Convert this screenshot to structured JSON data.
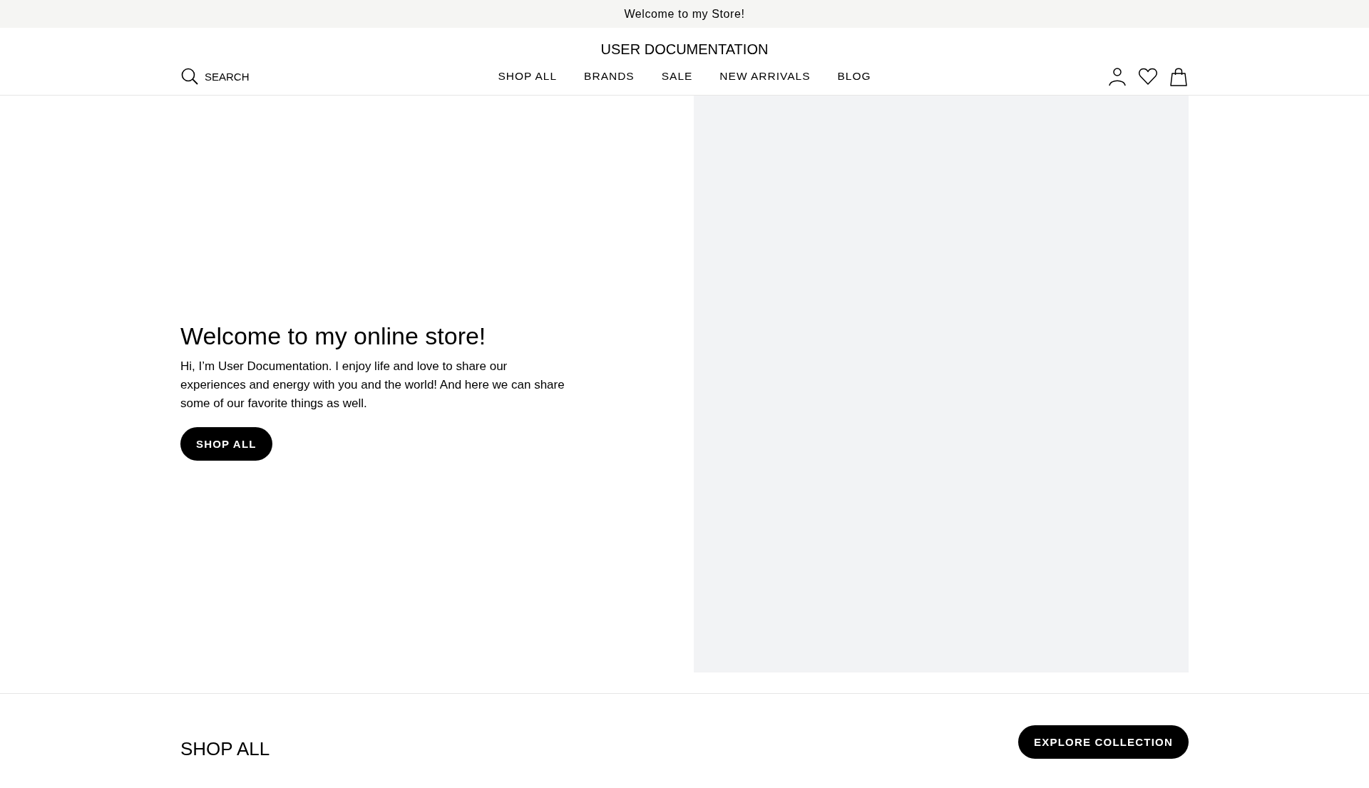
{
  "announcement": "Welcome to my Store!",
  "header": {
    "logo": "USER DOCUMENTATION",
    "search": "SEARCH",
    "nav": [
      "SHOP ALL",
      "BRANDS",
      "SALE",
      "NEW ARRIVALS",
      "BLOG"
    ]
  },
  "hero": {
    "title": "Welcome to my online store!",
    "text": "Hi, I’m User Documentation. I enjoy life and love to share our experiences and energy with you and the world! And here we can share some of our favorite things as well.",
    "button": "SHOP ALL"
  },
  "section": {
    "title": "SHOP ALL",
    "button": "EXPLORE COLLECTION"
  }
}
